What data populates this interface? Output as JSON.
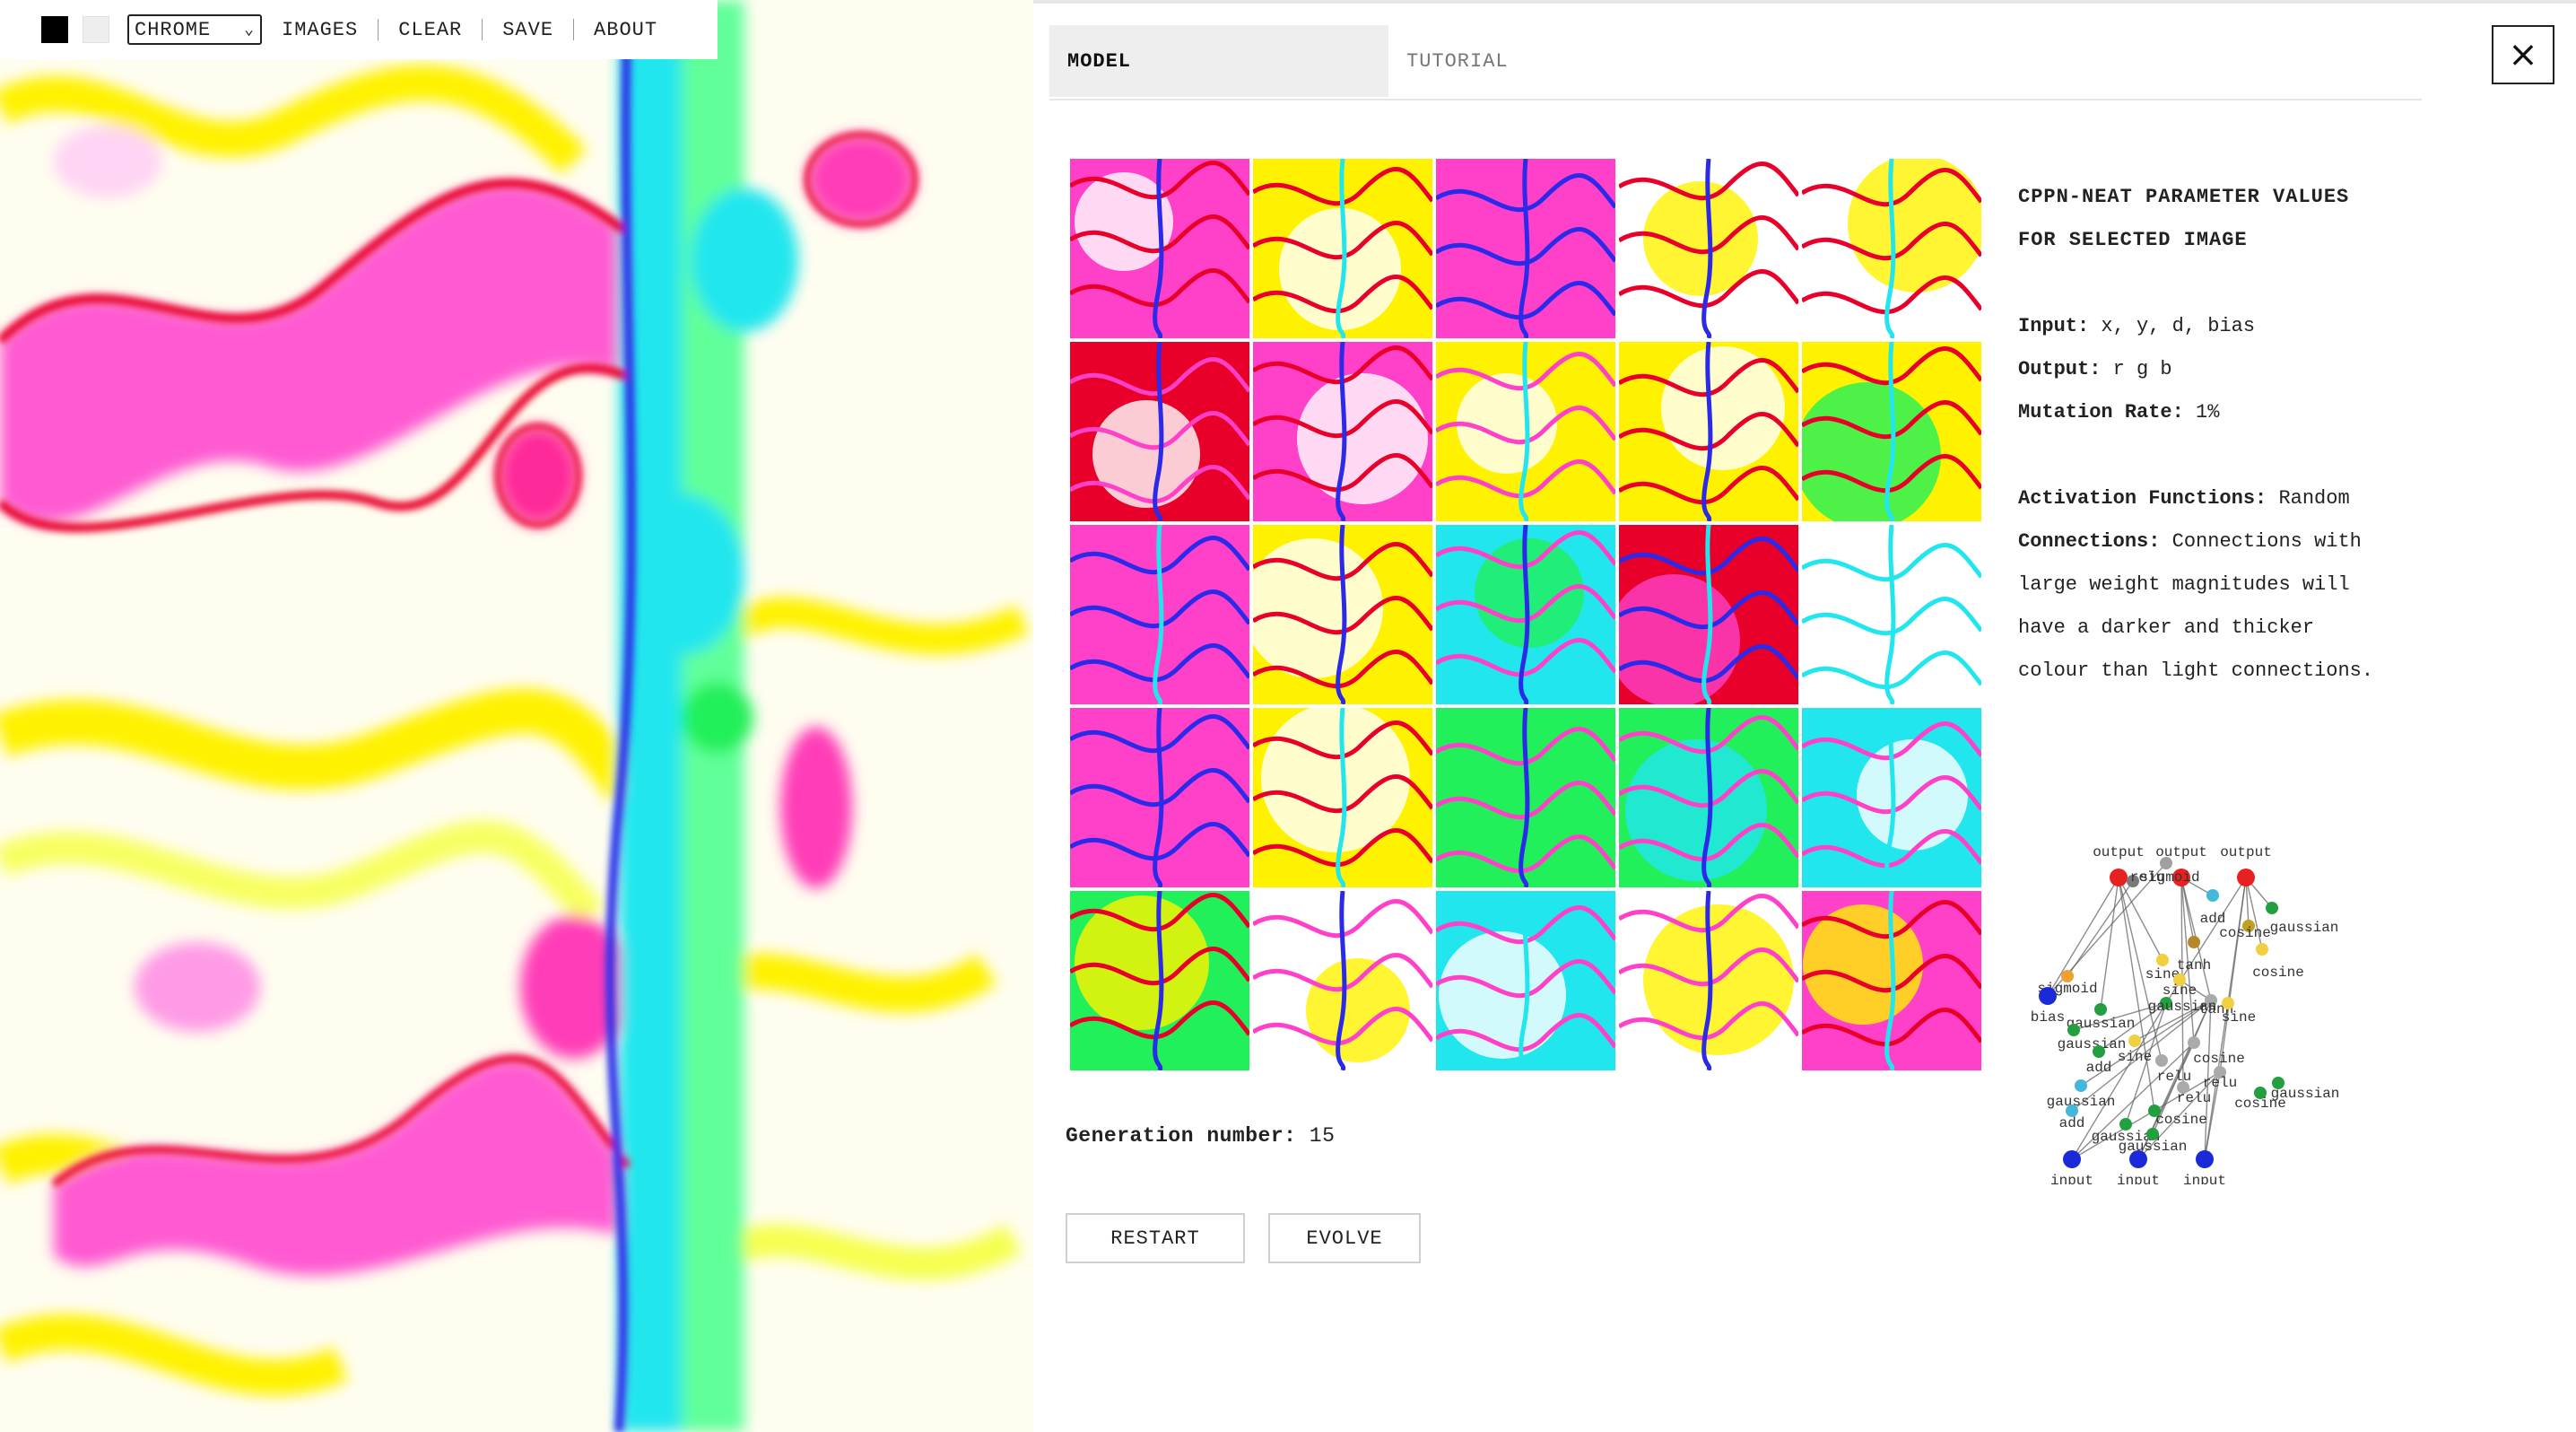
{
  "toolbar": {
    "mode_value": "CHROME",
    "links": [
      "IMAGES",
      "CLEAR",
      "SAVE",
      "ABOUT"
    ]
  },
  "tabs": {
    "model": "MODEL",
    "tutorial": "TUTORIAL"
  },
  "close_label": "×",
  "info": {
    "title_line1": "CPPN-NEAT PARAMETER VALUES",
    "title_line2": "FOR SELECTED IMAGE",
    "input_label": "Input:",
    "input_value": "x, y, d, bias",
    "output_label": "Output:",
    "output_value": "r g b",
    "mutation_label": "Mutation Rate:",
    "mutation_value": "1%",
    "activation_label": "Activation Functions:",
    "activation_value": "Random",
    "connections_label": "Connections:",
    "connections_line1": "Connections with",
    "connections_line2": "large weight magnitudes will",
    "connections_line3": "have a darker and thicker",
    "connections_line4": "colour than light connections."
  },
  "generation": {
    "label": "Generation number:",
    "value": "15"
  },
  "buttons": {
    "restart": "RESTART",
    "evolve": "EVOLVE"
  },
  "network": {
    "labels": [
      "output",
      "output",
      "output",
      "sigmoid",
      "relu",
      "add",
      "gaussian",
      "cosine",
      "tanh",
      "sine",
      "cosine",
      "sigmoid",
      "bias",
      "sine",
      "gaussian",
      "gaussian",
      "tanh",
      "gaussian",
      "sine",
      "add",
      "cosine",
      "sine",
      "relu",
      "gaussian",
      "relu",
      "relu",
      "cosine",
      "gaussian",
      "cosine",
      "add",
      "gaussian",
      "gaussian",
      "input",
      "input",
      "input"
    ]
  },
  "colors": {
    "pink": "#ff40c8",
    "red": "#e8002a",
    "yellow": "#fff200",
    "cyan": "#22e6ee",
    "green": "#22f05a",
    "blue": "#2a2ae8",
    "node_red": "#e82020",
    "node_blue": "#1a2ad8"
  }
}
